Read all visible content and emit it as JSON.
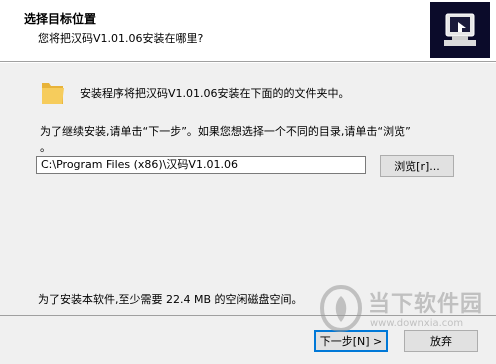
{
  "header": {
    "title": "选择目标位置",
    "subtitle": "您将把汉码V1.01.06安装在哪里?"
  },
  "main": {
    "install_line": "安装程序将把汉码V1.01.06安装在下面的的文件夹中。",
    "instruction_line1": "为了继续安装,请单击“下一步”。如果您想选择一个不同的目录,请单击“浏览”",
    "instruction_line2": "。",
    "path_value": "C:\\Program Files (x86)\\汉码V1.01.06",
    "browse_label": "浏览[r]...",
    "space_text": "为了安装本软件,至少需要 22.4 MB 的空闲磁盘空间。"
  },
  "footer": {
    "next_label": "下一步[N] >",
    "cancel_label": "放弃"
  },
  "watermark": {
    "brand": "当下软件园",
    "url": "www.downxia.com"
  },
  "colors": {
    "header_icon_bg": "#0b0b2a",
    "folder": "#f2c14e",
    "focus_border": "#0078d7"
  }
}
